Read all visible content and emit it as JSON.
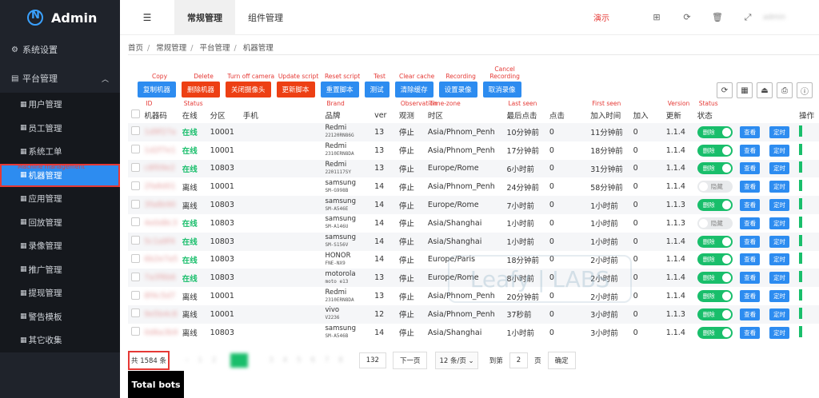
{
  "app": {
    "title": "Admin"
  },
  "sidebar": {
    "system": "系统设置",
    "platform": "平台管理",
    "items": [
      "用户管理",
      "员工管理",
      "系统工单",
      "机器管理",
      "应用管理",
      "回放管理",
      "录像管理",
      "推广管理",
      "提现管理",
      "警告模板",
      "其它收集"
    ],
    "active_annotation": "Machine management"
  },
  "topbar": {
    "tabs": [
      "常规管理",
      "组件管理"
    ],
    "demo": "演示",
    "user": "admin"
  },
  "breadcrumb": [
    "首页",
    "常规管理",
    "平台管理",
    "机器管理"
  ],
  "toolbar": {
    "buttons": [
      {
        "label": "复制机器",
        "anno": "Copy",
        "color": "blue"
      },
      {
        "label": "删除机器",
        "anno": "Delete",
        "color": "red"
      },
      {
        "label": "关闭摄像头",
        "anno": "Turn off camera",
        "color": "red"
      },
      {
        "label": "更新脚本",
        "anno": "Update script",
        "color": "red"
      },
      {
        "label": "重置脚本",
        "anno": "Reset script",
        "color": "blue"
      },
      {
        "label": "测试",
        "anno": "Test",
        "color": "blue"
      },
      {
        "label": "清除缓存",
        "anno": "Clear cache",
        "color": "blue"
      },
      {
        "label": "设置录像",
        "anno": "Recording",
        "color": "blue"
      },
      {
        "label": "取消录像",
        "anno": "Cancel Recording",
        "color": "blue"
      }
    ]
  },
  "table": {
    "headers": [
      "机器码",
      "在线",
      "分区",
      "手机",
      "品牌",
      "ver",
      "观测",
      "时区",
      "最后点击",
      "点击",
      "加入时间",
      "加入",
      "更新",
      "状态",
      "",
      "",
      "操作"
    ],
    "header_annos": {
      "id": "ID",
      "status": "Status",
      "brand": "Brand",
      "observation": "Observation",
      "timezone": "Time-zone",
      "lastseen": "Last seen",
      "firstseen": "First seen",
      "version": "Version",
      "status2": "Status"
    },
    "rows": [
      {
        "id": "1d9f27a",
        "online": "在线",
        "zone": "10001",
        "brand": "Redmi",
        "model": "22120RN86G",
        "ver": "13",
        "obs": "停止",
        "tz": "Asia/Phnom_Penh",
        "last": "10分钟前",
        "clicks": "0",
        "joined": "11分钟前",
        "join": "0",
        "update": "1.1.4",
        "status": "删除",
        "on": true
      },
      {
        "id": "1d2f7e1",
        "online": "在线",
        "zone": "10001",
        "brand": "Redmi",
        "model": "2310ERN8DA",
        "ver": "13",
        "obs": "停止",
        "tz": "Asia/Phnom_Penh",
        "last": "17分钟前",
        "clicks": "0",
        "joined": "18分钟前",
        "join": "0",
        "update": "1.1.4",
        "status": "删除",
        "on": true
      },
      {
        "id": "c8f09e2",
        "online": "在线",
        "zone": "10803",
        "brand": "Redmi",
        "model": "2201117SY",
        "ver": "13",
        "obs": "停止",
        "tz": "Europe/Rome",
        "last": "6小时前",
        "clicks": "0",
        "joined": "31分钟前",
        "join": "0",
        "update": "1.1.4",
        "status": "删除",
        "on": true
      },
      {
        "id": "2fa8d01",
        "online": "离线",
        "zone": "10001",
        "brand": "samsung",
        "model": "SM-G998B",
        "ver": "14",
        "obs": "停止",
        "tz": "Asia/Phnom_Penh",
        "last": "24分钟前",
        "clicks": "0",
        "joined": "58分钟前",
        "join": "0",
        "update": "1.1.4",
        "status": "隐藏",
        "on": false
      },
      {
        "id": "3fa8b90",
        "online": "离线",
        "zone": "10803",
        "brand": "samsung",
        "model": "SM-A546E",
        "ver": "14",
        "obs": "停止",
        "tz": "Europe/Rome",
        "last": "7小时前",
        "clicks": "0",
        "joined": "1小时前",
        "join": "0",
        "update": "1.1.3",
        "status": "删除",
        "on": true
      },
      {
        "id": "4e0d8c3",
        "online": "在线",
        "zone": "10803",
        "brand": "samsung",
        "model": "SM-A146U",
        "ver": "14",
        "obs": "停止",
        "tz": "Asia/Shanghai",
        "last": "1小时前",
        "clicks": "0",
        "joined": "1小时前",
        "join": "0",
        "update": "1.1.3",
        "status": "隐藏",
        "on": false
      },
      {
        "id": "5c1a9f4",
        "online": "在线",
        "zone": "10803",
        "brand": "samsung",
        "model": "SM-S156V",
        "ver": "14",
        "obs": "停止",
        "tz": "Asia/Shanghai",
        "last": "1小时前",
        "clicks": "0",
        "joined": "1小时前",
        "join": "0",
        "update": "1.1.4",
        "status": "删除",
        "on": true
      },
      {
        "id": "6b2e7a5",
        "online": "在线",
        "zone": "10803",
        "brand": "HONOR",
        "model": "FNE-NX9",
        "ver": "14",
        "obs": "停止",
        "tz": "Europe/Paris",
        "last": "18分钟前",
        "clicks": "0",
        "joined": "2小时前",
        "join": "0",
        "update": "1.1.4",
        "status": "删除",
        "on": true
      },
      {
        "id": "7a3f6b6",
        "online": "在线",
        "zone": "10803",
        "brand": "motorola",
        "model": "moto e13",
        "ver": "13",
        "obs": "停止",
        "tz": "Europe/Rome",
        "last": "8小时前",
        "clicks": "0",
        "joined": "2小时前",
        "join": "0",
        "update": "1.1.4",
        "status": "删除",
        "on": true
      },
      {
        "id": "8f4c5d7",
        "online": "离线",
        "zone": "10001",
        "brand": "Redmi",
        "model": "2310ERN8DA",
        "ver": "13",
        "obs": "停止",
        "tz": "Asia/Phnom_Penh",
        "last": "20分钟前",
        "clicks": "0",
        "joined": "2小时前",
        "join": "0",
        "update": "1.1.4",
        "status": "删除",
        "on": true
      },
      {
        "id": "9e5b4c8",
        "online": "离线",
        "zone": "10001",
        "brand": "vivo",
        "model": "V2236",
        "ver": "12",
        "obs": "停止",
        "tz": "Asia/Phnom_Penh",
        "last": "37秒前",
        "clicks": "0",
        "joined": "3小时前",
        "join": "0",
        "update": "1.1.3",
        "status": "删除",
        "on": true
      },
      {
        "id": "0d6a3b9",
        "online": "离线",
        "zone": "10803",
        "brand": "samsung",
        "model": "SM-A546B",
        "ver": "14",
        "obs": "停止",
        "tz": "Asia/Shanghai",
        "last": "1小时前",
        "clicks": "0",
        "joined": "3小时前",
        "join": "0",
        "update": "1.1.4",
        "status": "删除",
        "on": true
      }
    ],
    "view_label": "查看",
    "timer_label": "定时"
  },
  "pager": {
    "total": "共 1584 条",
    "last_page": "132",
    "next": "下一页",
    "per_page": "12 条/页",
    "goto": "到第",
    "goto_value": "2",
    "page_unit": "页",
    "confirm": "确定"
  },
  "watermark": "Leafy | LABS",
  "total_bots": "Total bots"
}
